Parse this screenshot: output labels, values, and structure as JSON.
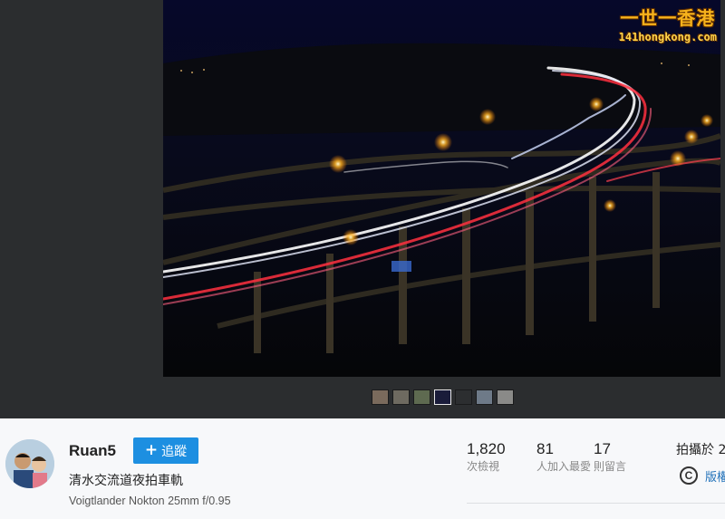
{
  "watermark": {
    "title": "一世一香港",
    "url": "141hongkong.com"
  },
  "photo": {
    "alt": "清水交流道夜拍車軌"
  },
  "thumbnails": [
    {
      "color": "#7a6a5c"
    },
    {
      "color": "#6e6a60"
    },
    {
      "color": "#5e6a50"
    },
    {
      "color": "#1a1c3a",
      "active": true
    },
    {
      "color": "#2c2e30"
    },
    {
      "color": "#6e7a88"
    },
    {
      "color": "#8a8a88"
    }
  ],
  "author": {
    "name": "Ruan5",
    "avatar_icon": "avatar-photo"
  },
  "follow": {
    "icon": "plus-icon",
    "label": "追蹤"
  },
  "photo_info": {
    "title": "清水交流道夜拍車軌",
    "lens": "Voigtlander Nokton 25mm f/0.95"
  },
  "stats": [
    {
      "value": "1,820",
      "label": "次檢視"
    },
    {
      "value": "81",
      "label": "人加入最愛"
    },
    {
      "value": "17",
      "label": "則留言"
    }
  ],
  "taken_label": "拍攝於 2",
  "license": {
    "icon": "copyright-icon",
    "label": "版權"
  }
}
